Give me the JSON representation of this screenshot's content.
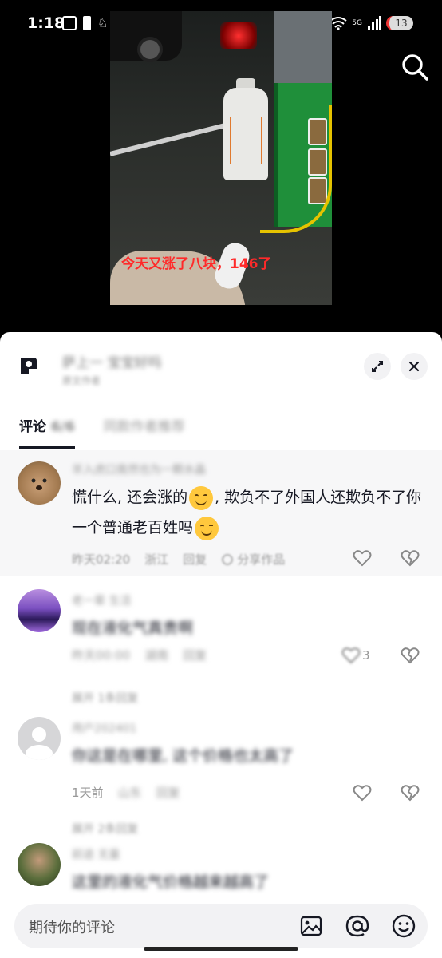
{
  "status_bar": {
    "time": "1:18",
    "network": "5G",
    "battery": "13"
  },
  "video": {
    "caption": "今天又涨了八块，146了"
  },
  "sheet": {
    "author_name": "萨上一 宝宝好吗",
    "author_sub": "原文作者",
    "tabs": [
      {
        "label": "评论",
        "count": "6/6"
      },
      {
        "label": "同款作者推荐"
      }
    ]
  },
  "comments": [
    {
      "user": "羊入虎口竟然也为一颗水晶",
      "text_part1": "慌什么, 还会涨的",
      "text_part2": ", 欺负不了外国人还欺负不了你一个普通老百姓吗",
      "time": "昨天02:20",
      "location": "浙江",
      "reply": "回复",
      "share": "分享作品",
      "likes": ""
    },
    {
      "user": "老一辈 生活",
      "text": "现在液化气真贵啊",
      "time": "昨天00:00",
      "location": "湖南",
      "reply": "回复",
      "likes": "3",
      "expand": "展开 1条回复"
    },
    {
      "user": "用户202401",
      "text": "你这是在哪里, 这个价格也太高了",
      "time": "1天前",
      "location": "山东",
      "reply": "回复",
      "likes": "",
      "expand": "展开 2条回复"
    },
    {
      "user": "前途 无量",
      "text": "这里的液化气价格越来越高了",
      "time": "",
      "location": "",
      "reply": ""
    }
  ],
  "input": {
    "placeholder": "期待你的评论"
  },
  "icons": {
    "search": "search-icon",
    "expand": "expand-icon",
    "close": "close-icon",
    "like": "heart-icon",
    "dislike": "broken-heart-icon",
    "image": "image-icon",
    "mention": "at-icon",
    "emoji": "emoji-icon"
  }
}
